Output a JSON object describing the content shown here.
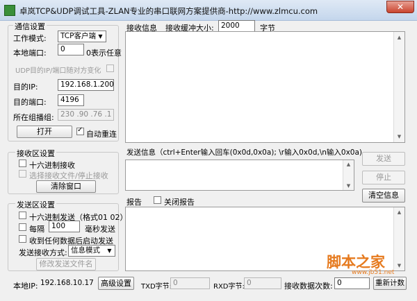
{
  "window": {
    "title": "卓岚TCP&UDP调试工具-ZLAN专业的串口联网方案提供商-http://www.zlmcu.com",
    "close_glyph": "✕"
  },
  "comm_settings": {
    "legend": "通信设置",
    "mode_label": "工作模式:",
    "mode_value": "TCP客户端",
    "local_port_label": "本地端口:",
    "local_port_value": "0",
    "local_port_hint": "0表示任意",
    "udp_follow_label": "UDP目的IP/端口随对方变化",
    "dest_ip_label": "目的IP:",
    "dest_ip_value": "192.168.1.200",
    "dest_port_label": "目的端口:",
    "dest_port_value": "4196",
    "multicast_label": "所在组播组:",
    "multicast_value": "230 .90 .76 .1",
    "open_button": "打开",
    "auto_reconnect_label": "自动重连"
  },
  "receive_settings": {
    "legend": "接收区设置",
    "hex_receive_label": "十六进制接收",
    "select_file_label": "选择接收文件/停止接收",
    "clear_button": "清除窗口"
  },
  "send_settings": {
    "legend": "发送区设置",
    "hex_send_label": "十六进制发送（格式01 02）",
    "every_label": "每隔",
    "interval_value": "100",
    "ms_label": "毫秒发送",
    "send_on_receive_label": "收到任何数据后启动发送",
    "send_mode_label": "发送接收方式:",
    "send_mode_value": "信息模式",
    "modify_file_button": "修改发送文件名"
  },
  "receive_panel": {
    "label": "接收信息",
    "buffer_label": "接收缓冲大小:",
    "buffer_value": "2000",
    "bytes_label": "字节"
  },
  "send_panel": {
    "label": "发送信息（ctrl+Enter输入回车(0x0d,0x0a); \\r输入0x0d,\\n输入0x0a)",
    "send_button": "发送",
    "stop_button": "停止",
    "clear_info_button": "清空信息"
  },
  "report_panel": {
    "label": "报告",
    "close_report_label": "关闭报告"
  },
  "status_bar": {
    "local_ip_label": "本地IP:",
    "local_ip_value": "192.168.10.17",
    "advanced_button": "高级设置",
    "txd_label": "TXD字节:",
    "txd_value": "0",
    "rxd_label": "RXD字节:",
    "rxd_value": "0",
    "recv_count_label": "接收数据次数:",
    "recv_count_value": "0",
    "recount_button": "重新计数"
  },
  "watermark": {
    "main": "脚本之家",
    "sub": "www.jb51.net"
  }
}
